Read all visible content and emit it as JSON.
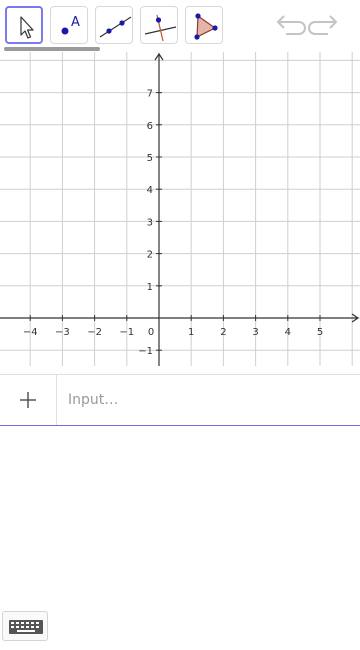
{
  "toolbar": {
    "tools": [
      {
        "name": "move-tool",
        "icon": "arrow-pointer-icon",
        "active": true
      },
      {
        "name": "point-tool",
        "icon": "point-icon",
        "label": "A"
      },
      {
        "name": "line-tool",
        "icon": "line-icon"
      },
      {
        "name": "perpendicular-tool",
        "icon": "perpendicular-icon"
      },
      {
        "name": "polygon-tool",
        "icon": "polygon-icon"
      }
    ],
    "undo_icon": "undo-icon",
    "redo_icon": "redo-icon"
  },
  "graph": {
    "x_ticks": [
      "−4",
      "−3",
      "−2",
      "−1",
      "0",
      "1",
      "2",
      "3",
      "4",
      "5"
    ],
    "y_ticks": [
      "7",
      "6",
      "5",
      "4",
      "3",
      "2",
      "1",
      "−1"
    ],
    "x_range": [
      -5,
      6
    ],
    "y_range": [
      -1.5,
      8
    ]
  },
  "algebra": {
    "add_icon": "plus-icon",
    "input_placeholder": "Input…"
  },
  "keyboard": {
    "icon": "keyboard-icon"
  },
  "colors": {
    "accent": "#7a7af0",
    "grid": "#cfcfcf",
    "axis": "#333333"
  }
}
